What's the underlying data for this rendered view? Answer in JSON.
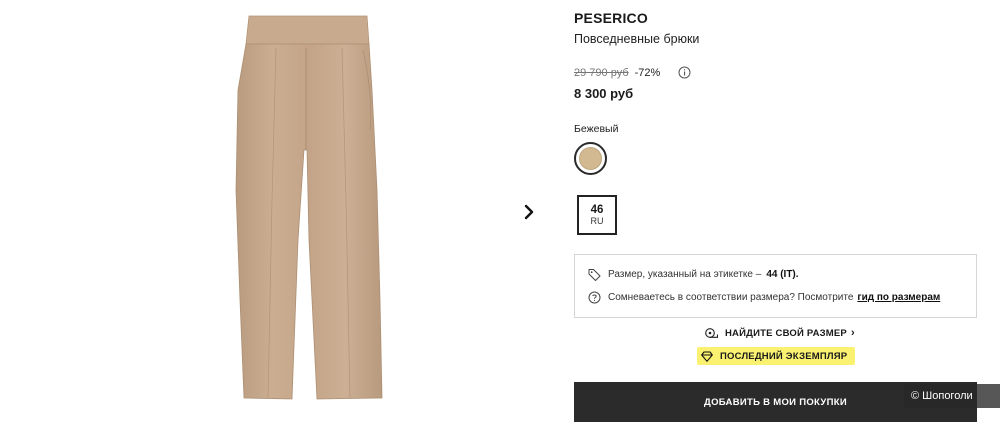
{
  "product": {
    "brand": "PESERICO",
    "subtitle": "Повседневные брюки",
    "old_price": "29 790 руб",
    "discount": "-72%",
    "price": "8 300 руб"
  },
  "color": {
    "label": "Бежевый",
    "swatch_hex": "#d2b992"
  },
  "size": {
    "number": "46",
    "region": "RU"
  },
  "size_info": {
    "label_text": "Размер, указанный на этикетке –",
    "label_size": "44 (IT).",
    "doubt_text": "Сомневаетесь в соответствии размера? Посмотрите",
    "guide_link": "гид по размерам"
  },
  "find_size": "НАЙДИТЕ СВОЙ РАЗМЕР",
  "badge": "ПОСЛЕДНИЙ ЭКЗЕМПЛЯР",
  "add_button": "ДОБАВИТЬ В МОИ ПОКУПКИ",
  "watermark": "© Шопоголи",
  "colors": {
    "button_bg": "#2b2b2b",
    "badge_bg": "#fbf170",
    "pants_fabric": "#c6a88c"
  },
  "icons": {
    "next": "chevron-right-icon",
    "info": "info-icon",
    "tag": "tag-icon",
    "help": "question-icon",
    "tape": "measuring-tape-icon",
    "diamond": "diamond-icon"
  }
}
